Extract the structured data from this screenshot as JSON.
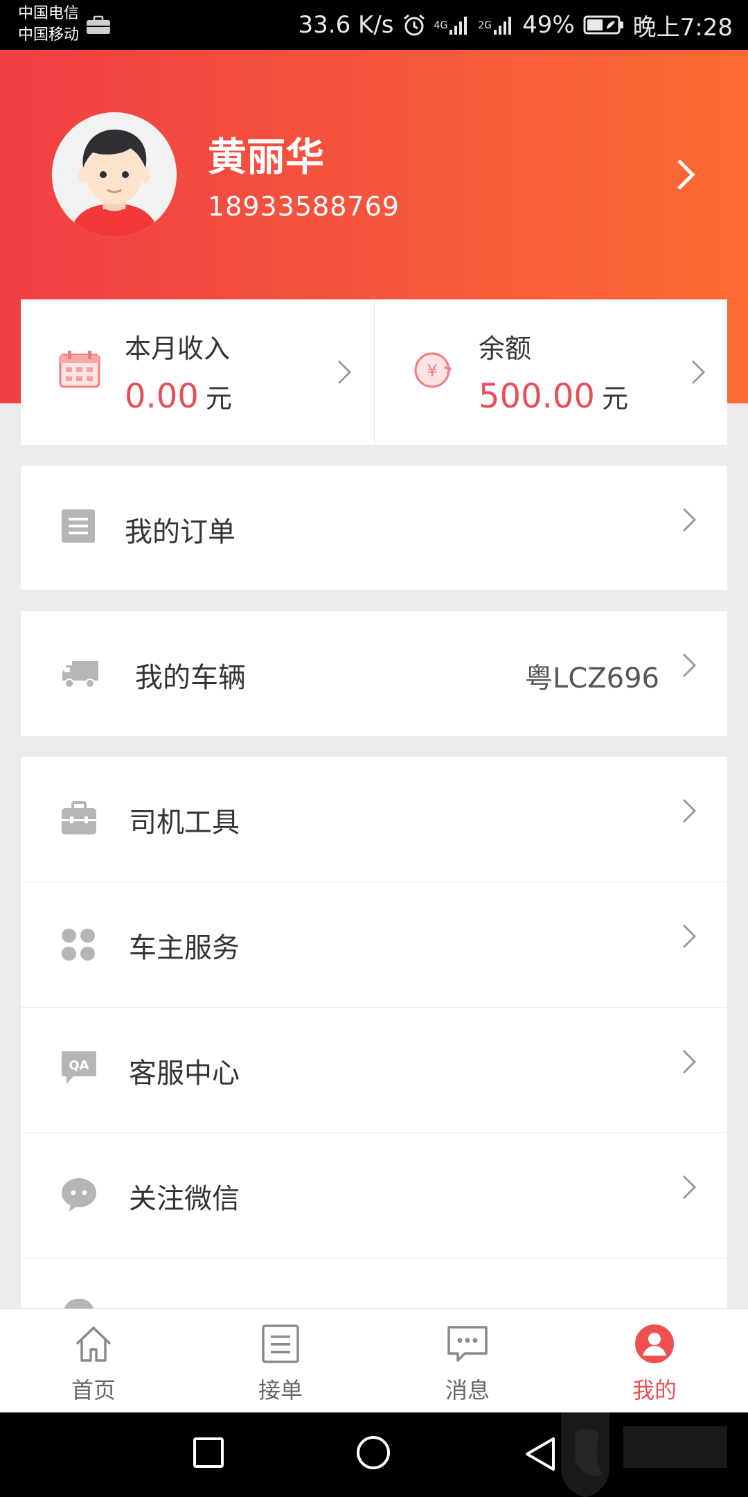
{
  "status_bar": {
    "carrier_1": "中国电信",
    "carrier_2": "中国移动",
    "net_speed": "33.6 K/s",
    "net_1": "4G",
    "net_2": "2G",
    "battery": "49%",
    "time": "晚上7:28"
  },
  "profile": {
    "name": "黄丽华",
    "phone": "18933588769"
  },
  "stats": {
    "income_label": "本月收入",
    "income_value": "0.00",
    "income_unit": "元",
    "balance_label": "余额",
    "balance_value": "500.00",
    "balance_unit": "元"
  },
  "menu": {
    "orders": "我的订单",
    "vehicle": "我的车辆",
    "vehicle_plate": "粤LCZ696",
    "tools": "司机工具",
    "owner_service": "车主服务",
    "customer_service": "客服中心",
    "wechat": "关注微信"
  },
  "tabs": {
    "home": "首页",
    "orders": "接单",
    "messages": "消息",
    "mine": "我的"
  },
  "colors": {
    "accent": "#ee4f4f",
    "header_start": "#f13f44",
    "header_end": "#fd6a32"
  }
}
